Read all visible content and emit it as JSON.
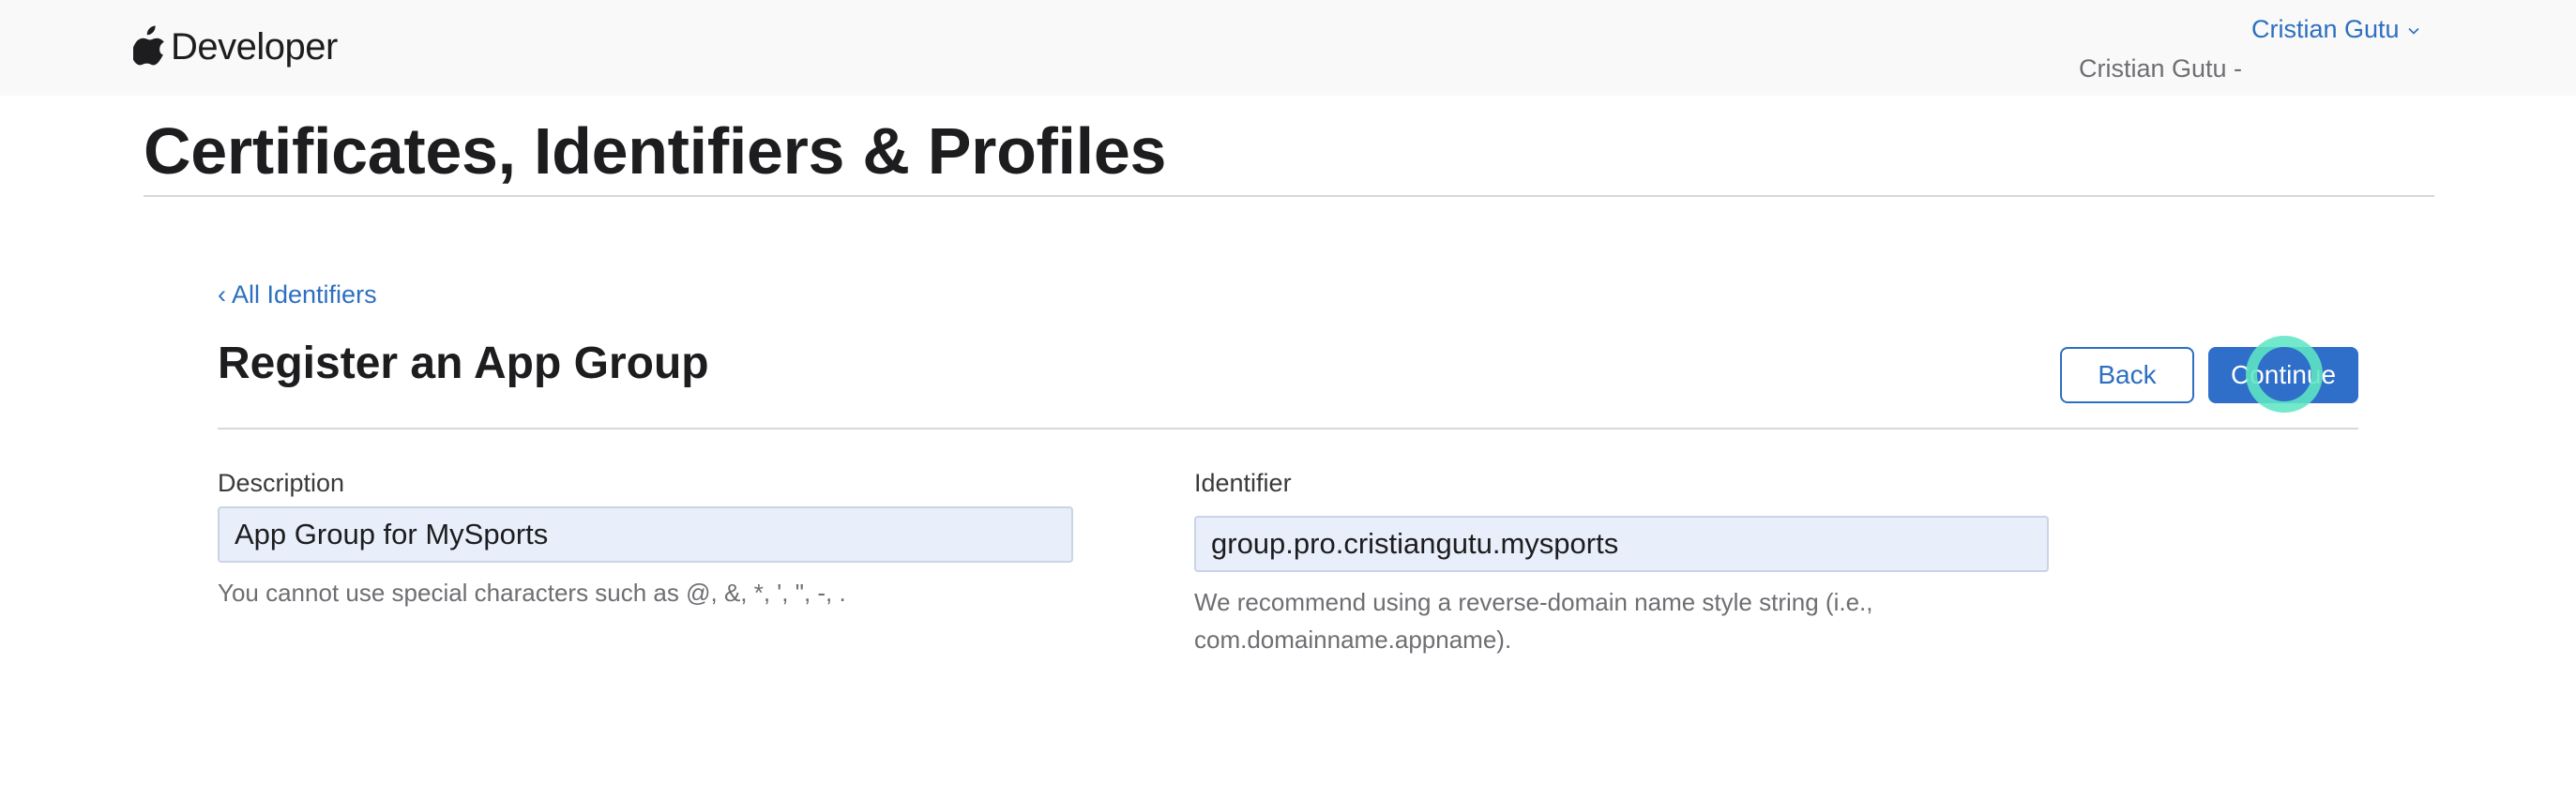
{
  "header": {
    "logo_text": "Developer",
    "user_name": "Cristian Gutu",
    "team_name": "Cristian Gutu -"
  },
  "page": {
    "title": "Certificates, Identifiers & Profiles"
  },
  "form": {
    "back_link": "‹ All Identifiers",
    "title": "Register an App Group",
    "back_button": "Back",
    "continue_button": "Continue",
    "description": {
      "label": "Description",
      "value": "App Group for MySports",
      "hint": "You cannot use special characters such as @, &, *, ', \", -, ."
    },
    "identifier": {
      "label": "Identifier",
      "value": "group.pro.cristiangutu.mysports",
      "hint_line1": "We recommend using a reverse-domain name style string (i.e.,",
      "hint_line2": "com.domainname.appname)."
    }
  },
  "colors": {
    "accent": "#2d6fc0",
    "button_primary": "#2f6fc9",
    "input_background": "#e8eefa",
    "click_indicator": "#60e6c4"
  }
}
